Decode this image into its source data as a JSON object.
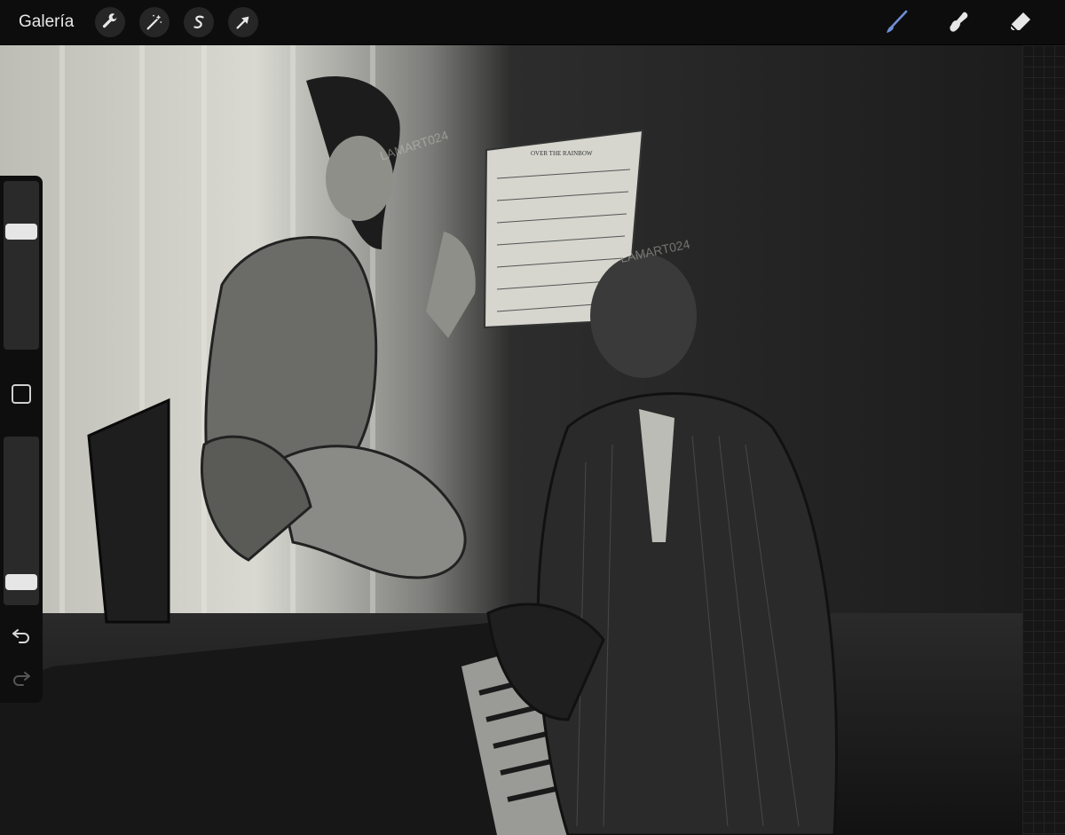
{
  "toolbar": {
    "gallery_label": "Galería",
    "tools": [
      {
        "name": "actions",
        "icon": "wrench-icon"
      },
      {
        "name": "adjustments",
        "icon": "magic-wand-icon"
      },
      {
        "name": "selection",
        "icon": "selection-s-icon"
      },
      {
        "name": "transform",
        "icon": "arrow-cursor-icon"
      }
    ],
    "right_tools": [
      {
        "name": "brush",
        "icon": "brush-icon",
        "active": true
      },
      {
        "name": "smudge",
        "icon": "smudge-icon"
      },
      {
        "name": "eraser",
        "icon": "eraser-icon"
      }
    ]
  },
  "sidebar": {
    "brush_size": 0.28,
    "opacity": 0.9
  },
  "canvas": {
    "sheet_title": "OVER THE RAINBOW",
    "watermark": "LAMART024"
  },
  "colors": {
    "accent": "#6f8fd6",
    "toolbar_bg": "#0d0d0d"
  }
}
